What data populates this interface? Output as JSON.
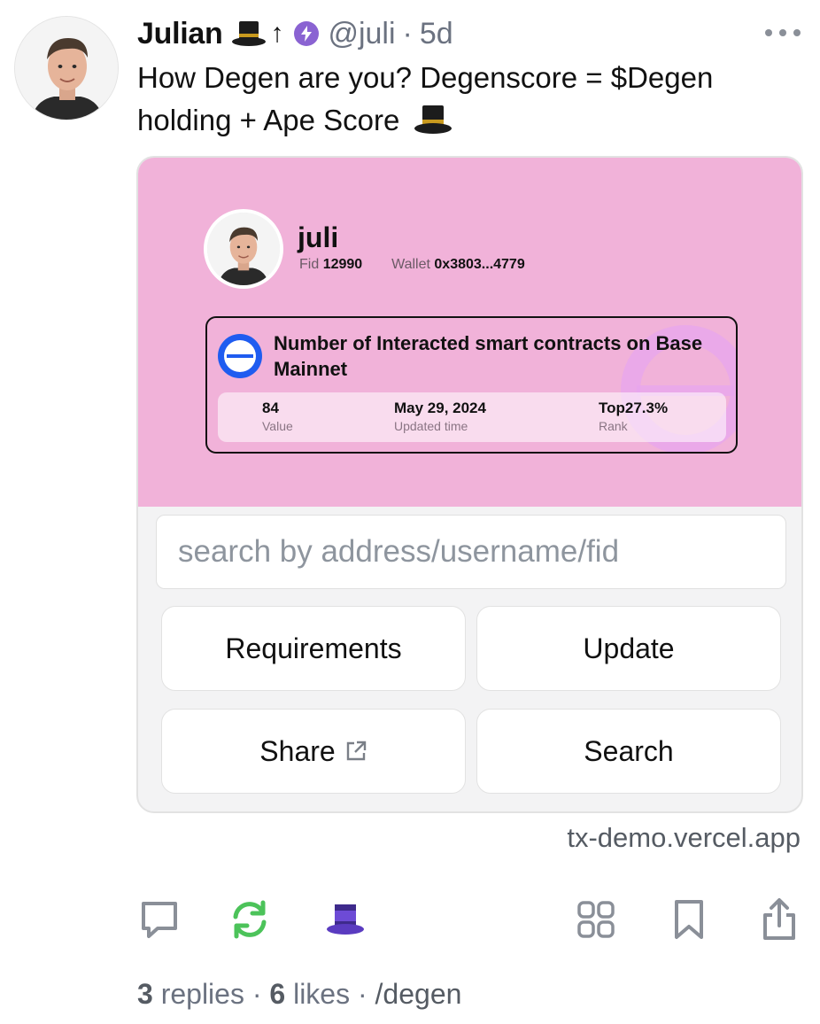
{
  "author": {
    "display_name": "Julian",
    "display_emoji": "🎩",
    "arrow": "↑",
    "username": "@juli",
    "age": "5d"
  },
  "cast": {
    "text": "How Degen are you? Degenscore = $Degen holding + Ape Score"
  },
  "frame": {
    "profile": {
      "name": "juli",
      "fid_label": "Fid",
      "fid_value": "12990",
      "wallet_label": "Wallet",
      "wallet_value": "0x3803...4779"
    },
    "card": {
      "title": "Number of Interacted smart contracts on Base Mainnet",
      "stats": [
        {
          "value": "84",
          "label": "Value"
        },
        {
          "value": "May 29, 2024",
          "label": "Updated time"
        },
        {
          "value": "Top27.3%",
          "label": "Rank"
        }
      ]
    },
    "background_color": "#f1b2d9",
    "search_placeholder": "search by address/username/fid",
    "buttons": {
      "requirements": "Requirements",
      "update": "Update",
      "share": "Share",
      "search": "Search"
    },
    "domain": "tx-demo.vercel.app"
  },
  "actions": {
    "icons": [
      "comment-icon",
      "recast-icon",
      "tip-hat-icon",
      "grid-icon",
      "bookmark-icon",
      "share-icon"
    ],
    "recast_color": "#4cc35a",
    "hat_color": "#6d4bd6"
  },
  "footer": {
    "replies_count": "3",
    "replies_label": "replies",
    "likes_count": "6",
    "likes_label": "likes",
    "channel": "/degen"
  }
}
